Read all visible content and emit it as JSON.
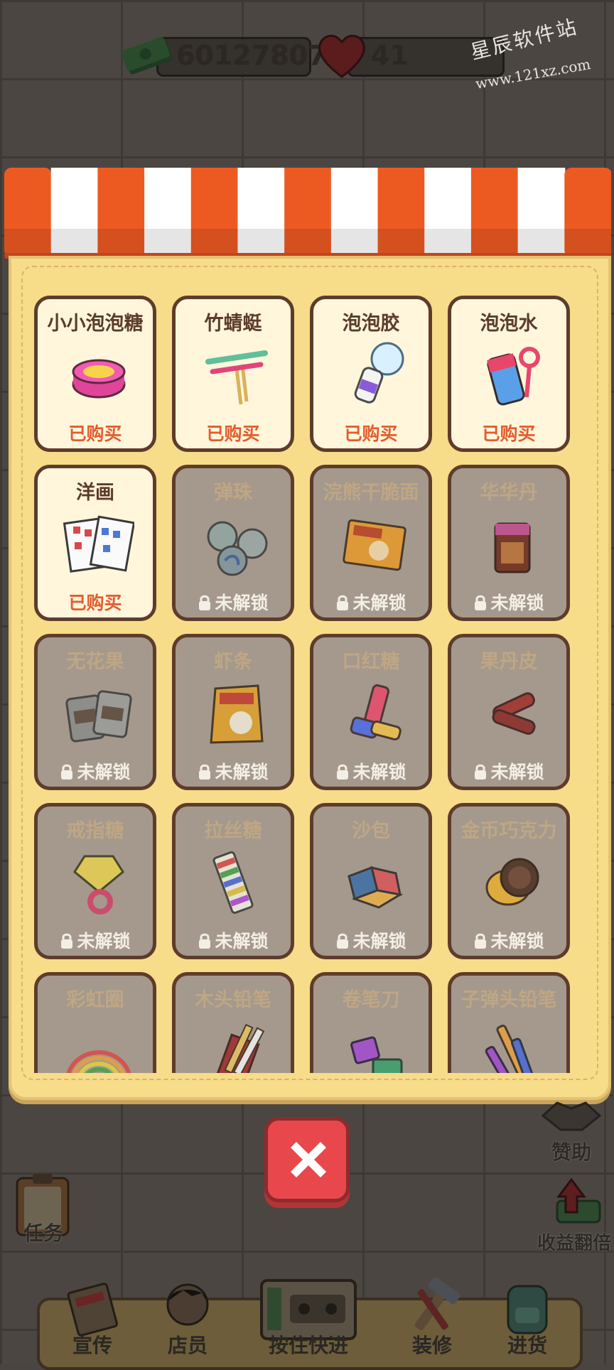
{
  "topbar": {
    "money": "601278078",
    "hearts": "41",
    "money_icon": "cash-stack-icon",
    "heart_icon": "heart-icon"
  },
  "watermark": {
    "text": "星辰软件站",
    "url": "www.121xz.com"
  },
  "shop": {
    "items": [
      {
        "name": "小小泡泡糖",
        "status": "已购买",
        "locked": false,
        "icon": "bubble-gum-tin-icon"
      },
      {
        "name": "竹蜻蜓",
        "status": "已购买",
        "locked": false,
        "icon": "bamboo-dragonfly-icon"
      },
      {
        "name": "泡泡胶",
        "status": "已购买",
        "locked": false,
        "icon": "bubble-glue-icon"
      },
      {
        "name": "泡泡水",
        "status": "已购买",
        "locked": false,
        "icon": "bubble-water-icon"
      },
      {
        "name": "洋画",
        "status": "已购买",
        "locked": false,
        "icon": "picture-cards-icon"
      },
      {
        "name": "弹珠",
        "status": "未解锁",
        "locked": true,
        "icon": "marbles-icon"
      },
      {
        "name": "浣熊干脆面",
        "status": "未解锁",
        "locked": true,
        "icon": "noodle-snack-icon"
      },
      {
        "name": "华华丹",
        "status": "未解锁",
        "locked": true,
        "icon": "candy-box-icon"
      },
      {
        "name": "无花果",
        "status": "未解锁",
        "locked": true,
        "icon": "fig-snack-icon"
      },
      {
        "name": "虾条",
        "status": "未解锁",
        "locked": true,
        "icon": "shrimp-chips-icon"
      },
      {
        "name": "口红糖",
        "status": "未解锁",
        "locked": true,
        "icon": "lipstick-candy-icon"
      },
      {
        "name": "果丹皮",
        "status": "未解锁",
        "locked": true,
        "icon": "fruit-roll-icon"
      },
      {
        "name": "戒指糖",
        "status": "未解锁",
        "locked": true,
        "icon": "ring-candy-icon"
      },
      {
        "name": "拉丝糖",
        "status": "未解锁",
        "locked": true,
        "icon": "stripe-candy-icon"
      },
      {
        "name": "沙包",
        "status": "未解锁",
        "locked": true,
        "icon": "sandbag-icon"
      },
      {
        "name": "金币巧克力",
        "status": "未解锁",
        "locked": true,
        "icon": "coin-chocolate-icon"
      },
      {
        "name": "彩虹圈",
        "status": "",
        "locked": true,
        "icon": "rainbow-spring-icon"
      },
      {
        "name": "木头铅笔",
        "status": "",
        "locked": true,
        "icon": "wooden-pencils-icon"
      },
      {
        "name": "卷笔刀",
        "status": "",
        "locked": true,
        "icon": "pencil-sharpener-icon"
      },
      {
        "name": "子弹头铅笔",
        "status": "",
        "locked": true,
        "icon": "bullet-pencil-icon"
      }
    ]
  },
  "side": {
    "sponsor": "赞助",
    "double_income": "收益翻倍",
    "task": "任务"
  },
  "nav": {
    "promote": "宣传",
    "staff": "店员",
    "fast_forward": "按住快进",
    "decorate": "装修",
    "restock": "进货"
  },
  "colors": {
    "accent_orange": "#ec5a22",
    "purchased_text": "#e35c2d",
    "close_red": "#e8484b",
    "panel_yellow": "#f7dc8a"
  }
}
